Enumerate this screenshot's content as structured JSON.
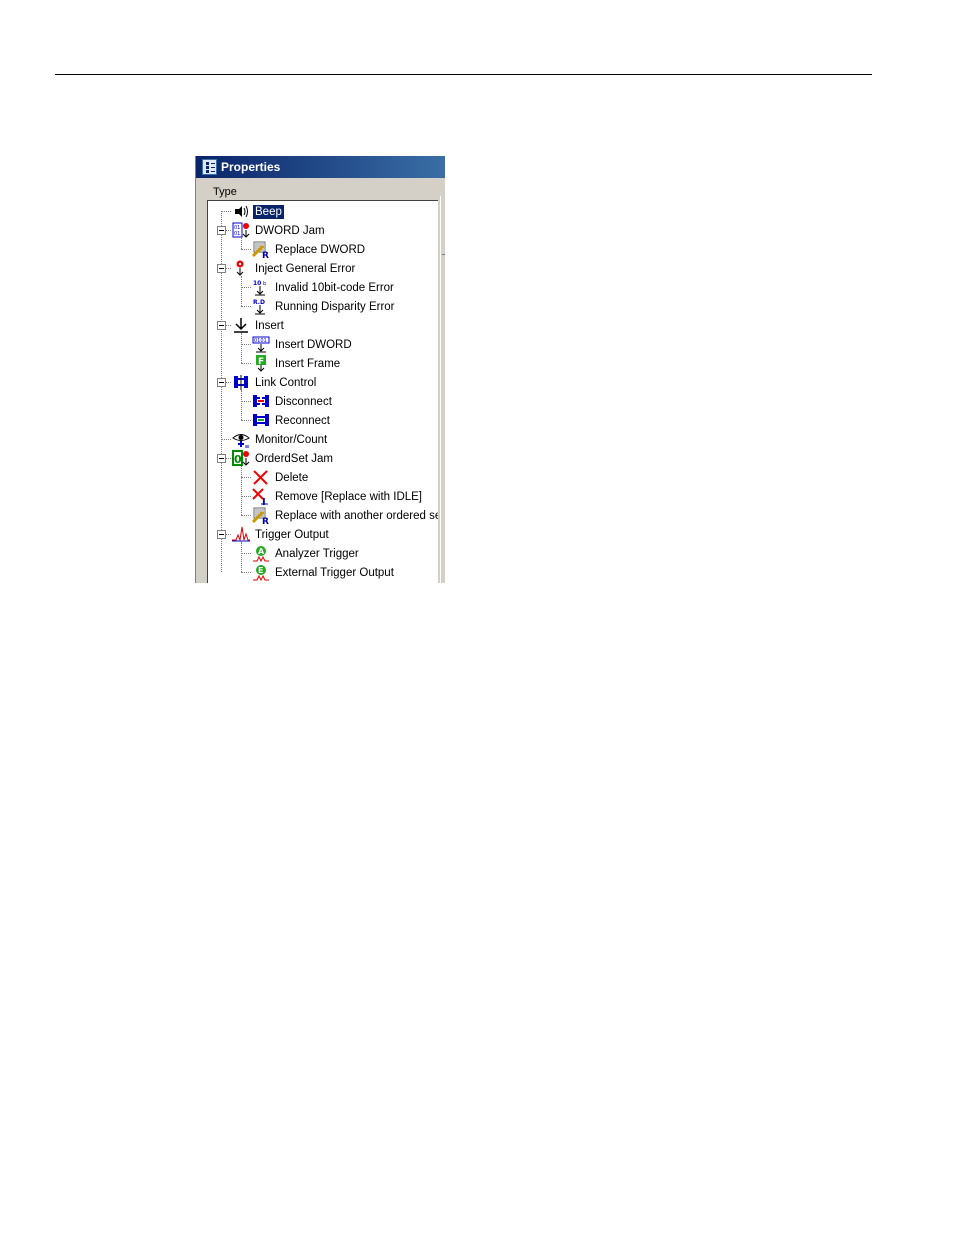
{
  "window": {
    "title": "Properties",
    "type_label": "Type"
  },
  "tree": {
    "items": [
      {
        "label": "Beep",
        "icon": "beep-speaker-icon",
        "level": 0,
        "selected": true
      },
      {
        "label": "DWORD Jam",
        "icon": "dword-jam-icon",
        "level": 0,
        "expanded": true
      },
      {
        "label": "Replace DWORD",
        "icon": "replace-icon",
        "level": 1
      },
      {
        "label": "Inject General Error",
        "icon": "inject-error-icon",
        "level": 0,
        "expanded": true
      },
      {
        "label": "Invalid 10bit-code Error",
        "icon": "invalid-10bit-icon",
        "level": 1
      },
      {
        "label": "Running Disparity Error",
        "icon": "running-disparity-icon",
        "level": 1
      },
      {
        "label": "Insert",
        "icon": "insert-arrow-icon",
        "level": 0,
        "expanded": true
      },
      {
        "label": "Insert DWORD",
        "icon": "insert-dword-icon",
        "level": 1
      },
      {
        "label": "Insert Frame",
        "icon": "insert-frame-icon",
        "level": 1
      },
      {
        "label": "Link Control",
        "icon": "link-control-icon",
        "level": 0,
        "expanded": true
      },
      {
        "label": "Disconnect",
        "icon": "disconnect-icon",
        "level": 1
      },
      {
        "label": "Reconnect",
        "icon": "reconnect-icon",
        "level": 1
      },
      {
        "label": "Monitor/Count",
        "icon": "monitor-eye-icon",
        "level": 0
      },
      {
        "label": "OrderdSet Jam",
        "icon": "orderedset-jam-icon",
        "level": 0,
        "expanded": true
      },
      {
        "label": "Delete",
        "icon": "delete-x-icon",
        "level": 1
      },
      {
        "label": "Remove [Replace with IDLE]",
        "icon": "remove-idle-icon",
        "level": 1
      },
      {
        "label": "Replace with another ordered se",
        "icon": "replace-icon",
        "level": 1
      },
      {
        "label": "Trigger Output",
        "icon": "trigger-waveform-icon",
        "level": 0,
        "expanded": true
      },
      {
        "label": "Analyzer Trigger",
        "icon": "analyzer-trigger-icon",
        "level": 1
      },
      {
        "label": "External Trigger Output",
        "icon": "external-trigger-icon",
        "level": 1
      }
    ]
  },
  "colors": {
    "titlebar": "#0a246a",
    "selection": "#0a246a",
    "panel": "#d4d0c8"
  }
}
